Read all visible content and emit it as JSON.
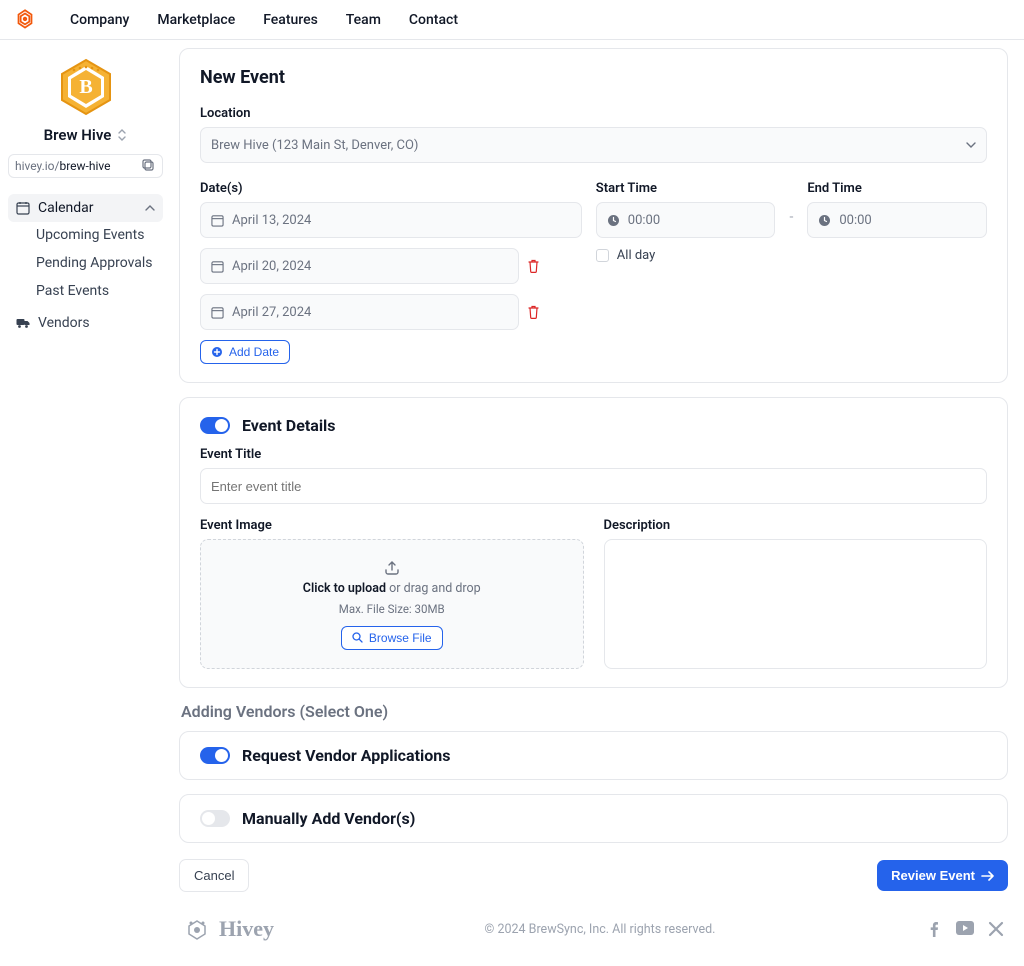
{
  "nav": {
    "items": [
      "Company",
      "Marketplace",
      "Features",
      "Team",
      "Contact"
    ]
  },
  "sidebar": {
    "org_name": "Brew Hive",
    "slug_prefix": "hivey.io/",
    "slug": "brew-hive",
    "calendar_label": "Calendar",
    "upcoming_label": "Upcoming Events",
    "pending_label": "Pending Approvals",
    "past_label": "Past Events",
    "vendors_label": "Vendors"
  },
  "form": {
    "title": "New Event",
    "location_label": "Location",
    "location_value": "Brew Hive (123 Main St, Denver, CO)",
    "dates_label": "Date(s)",
    "dates": [
      "April 13, 2024",
      "April 20, 2024",
      "April 27, 2024"
    ],
    "add_date_label": "Add Date",
    "start_time_label": "Start Time",
    "start_time_value": "00:00",
    "end_time_label": "End Time",
    "end_time_value": "00:00",
    "all_day_label": "All day",
    "details_title": "Event Details",
    "event_title_label": "Event Title",
    "event_title_placeholder": "Enter event title",
    "event_image_label": "Event Image",
    "description_label": "Description",
    "dropzone_strong": "Click to upload",
    "dropzone_rest": " or drag and drop",
    "dropzone_hint": "Max. File Size: 30MB",
    "browse_file_label": "Browse File",
    "vendor_heading": "Adding Vendors (Select One)",
    "request_vendor_label": "Request Vendor Applications",
    "manual_vendor_label": "Manually Add Vendor(s)",
    "cancel_label": "Cancel",
    "review_label": "Review Event"
  },
  "footer": {
    "brand": "Hivey",
    "copyright": "© 2024 BrewSync, Inc. All rights reserved."
  }
}
